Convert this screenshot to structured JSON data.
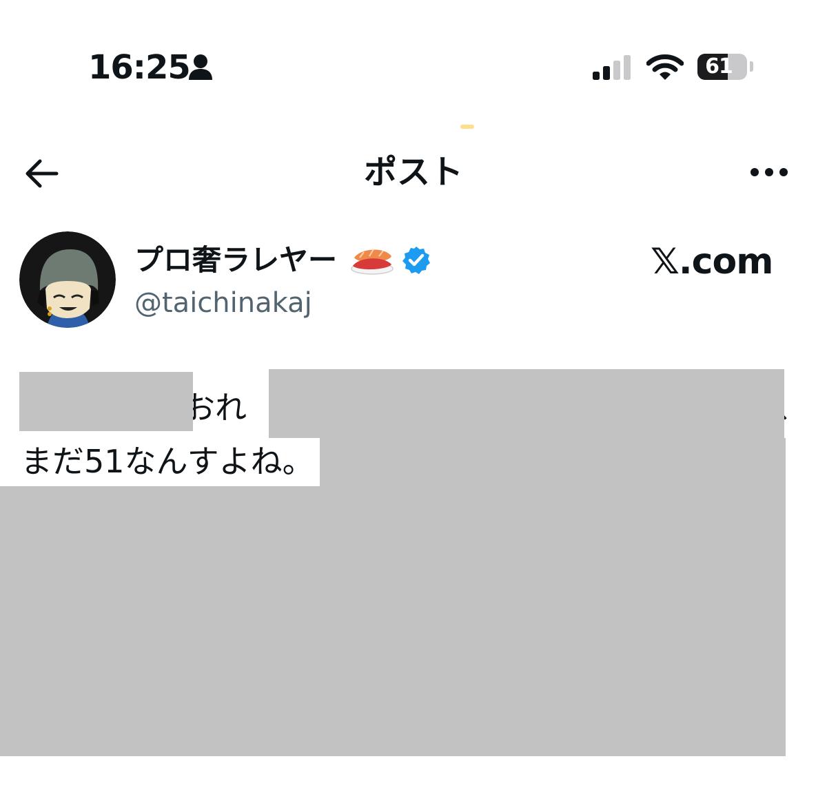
{
  "status_bar": {
    "time": "16:25",
    "battery_percent": 61,
    "battery_label": "61",
    "person_icon": "person-icon",
    "signal_icon": "cellular-signal-icon",
    "wifi_icon": "wifi-icon"
  },
  "header": {
    "title": "ポスト",
    "back_icon": "arrow-left-icon",
    "more_icon": "more-horizontal-icon"
  },
  "post": {
    "author_name": "プロ奢ラレヤー",
    "author_emoji_icon": "sushi-icon",
    "verified_icon": "verified-badge-icon",
    "handle": "@taichinakaj",
    "watermark": "𝕏.com",
    "text_line1_visible": "おれ",
    "text_line2": "まだ51なんすよね。"
  },
  "colors": {
    "text": "#0f1419",
    "handle": "#536471",
    "verified": "#1d9bf0",
    "redaction": "#c2c2c2",
    "background": "#ffffff"
  }
}
